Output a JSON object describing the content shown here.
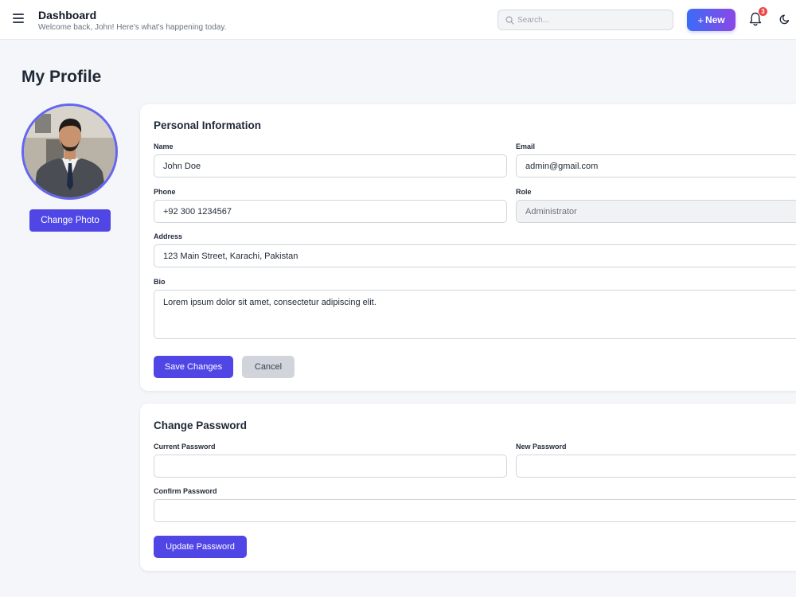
{
  "header": {
    "title": "Dashboard",
    "subtitle": "Welcome back, John! Here's what's happening today.",
    "search_placeholder": "Search...",
    "new_button_label": "New",
    "notification_count": "3",
    "icons": [
      "menu-icon",
      "search-icon",
      "plus-icon",
      "bell-icon",
      "moon-icon"
    ]
  },
  "page": {
    "title": "My Profile"
  },
  "profile": {
    "change_photo_label": "Change Photo"
  },
  "personal_info": {
    "heading": "Personal Information",
    "name_label": "Name",
    "name_value": "John Doe",
    "email_label": "Email",
    "email_value": "admin@gmail.com",
    "phone_label": "Phone",
    "phone_value": "+92 300 1234567",
    "role_label": "Role",
    "role_value": "Administrator",
    "address_label": "Address",
    "address_value": "123 Main Street, Karachi, Pakistan",
    "bio_label": "Bio",
    "bio_value": "Lorem ipsum dolor sit amet, consectetur adipiscing elit.",
    "save_label": "Save Changes",
    "cancel_label": "Cancel"
  },
  "password": {
    "heading": "Change Password",
    "current_label": "Current Password",
    "current_value": "",
    "new_label": "New Password",
    "new_value": "",
    "confirm_label": "Confirm Password",
    "confirm_value": "",
    "update_label": "Update Password"
  },
  "colors": {
    "accent": "#4f46e5",
    "avatar_ring": "#6366f1",
    "badge": "#ef4444",
    "gradient_start": "#3b6cf6",
    "gradient_end": "#8b48e6",
    "background": "#f5f6f9"
  }
}
